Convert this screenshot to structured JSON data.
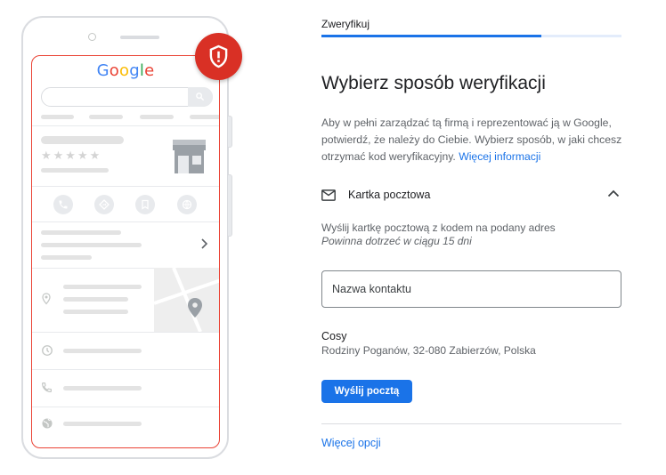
{
  "phone_illustration": {
    "logo": [
      "G",
      "o",
      "o",
      "g",
      "l",
      "e"
    ],
    "logo_colors": [
      "#4285f4",
      "#ea4335",
      "#fbbc05",
      "#4285f4",
      "#34a853",
      "#ea4335"
    ],
    "stars": "★★★★★",
    "action_icons": [
      "phone-icon",
      "directions-icon",
      "bookmark-icon",
      "website-icon"
    ],
    "row_icons": [
      "location-pin-icon",
      "clock-icon",
      "phone-icon",
      "globe-icon"
    ],
    "badge_icon": "shield-alert-icon",
    "badge_color": "#d93025"
  },
  "header": {
    "step_label": "Zweryfikuj",
    "progress": 0.732
  },
  "main": {
    "title": "Wybierz sposób weryfikacji",
    "description": "Aby w pełni zarządzać tą firmą i reprezentować ją w Google, potwierdź, że należy do Ciebie. Wybierz sposób, w jaki chcesz otrzymać kod weryfikacyjny.",
    "more_info_link": "Więcej informacji",
    "method": {
      "icon": "mail-icon",
      "label": "Kartka pocztowa",
      "expand_icon": "chevron-up-icon",
      "info": "Wyślij kartkę pocztową z kodem na podany adres",
      "eta": "Powinna dotrzeć w ciągu 15 dni"
    },
    "contact_field": {
      "placeholder": "Nazwa kontaktu",
      "value": ""
    },
    "business": {
      "name": "Cosy",
      "address": "Rodziny Poganów, 32-080 Zabierzów, Polska"
    },
    "send_button": "Wyślij pocztą",
    "more_options_link": "Więcej opcji"
  },
  "colors": {
    "accent": "#1a73e8",
    "error": "#d93025"
  }
}
